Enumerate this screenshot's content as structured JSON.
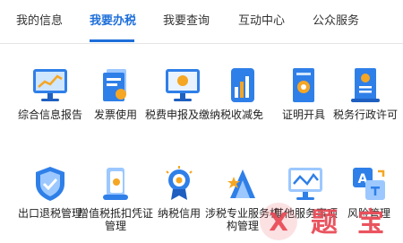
{
  "tabs": [
    {
      "label": "我的信息"
    },
    {
      "label": "我要办税",
      "active": true
    },
    {
      "label": "我要查询"
    },
    {
      "label": "互动中心"
    },
    {
      "label": "公众服务"
    }
  ],
  "services": [
    {
      "label": "综合信息报告",
      "icon": "monitor-chart-icon"
    },
    {
      "label": "发票使用",
      "icon": "invoice-icon"
    },
    {
      "label": "税费申报及缴纳",
      "icon": "declaration-icon"
    },
    {
      "label": "税收减免",
      "icon": "tax-reduction-icon"
    },
    {
      "label": "证明开具",
      "icon": "certificate-icon"
    },
    {
      "label": "税务行政许可",
      "icon": "license-icon"
    },
    {
      "label": "出口退税管理",
      "icon": "shield-icon"
    },
    {
      "label": "增值税抵扣凭证管理",
      "icon": "vat-voucher-icon"
    },
    {
      "label": "纳税信用",
      "icon": "credit-badge-icon"
    },
    {
      "label": "涉税专业服务机构管理",
      "icon": "professional-service-icon"
    },
    {
      "label": "其他服务事项",
      "icon": "monitor-line-icon"
    },
    {
      "label": "风险管理",
      "icon": "risk-translate-icon"
    }
  ],
  "colors": {
    "accent": "#1e6fd9",
    "watermark": "#e94b57"
  },
  "watermark_text": "X 题 宝"
}
